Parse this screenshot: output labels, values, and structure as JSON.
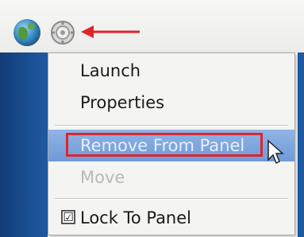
{
  "menu": {
    "items": [
      {
        "label": "Launch",
        "enabled": true
      },
      {
        "label": "Properties",
        "enabled": true
      },
      {
        "label": "Remove From Panel",
        "enabled": true,
        "highlighted": true
      },
      {
        "label": "Move",
        "enabled": false
      },
      {
        "label": "Lock To Panel",
        "enabled": true,
        "checked": true,
        "check_glyph": "☑"
      }
    ]
  },
  "colors": {
    "annotation_red": "#e0242a",
    "selection_blue": "#7ea6de",
    "desktop_blue": "#1a4d8f"
  },
  "icons": [
    "globe-icon",
    "gear-launcher-icon",
    "annotation-arrow",
    "mouse-pointer-icon"
  ]
}
